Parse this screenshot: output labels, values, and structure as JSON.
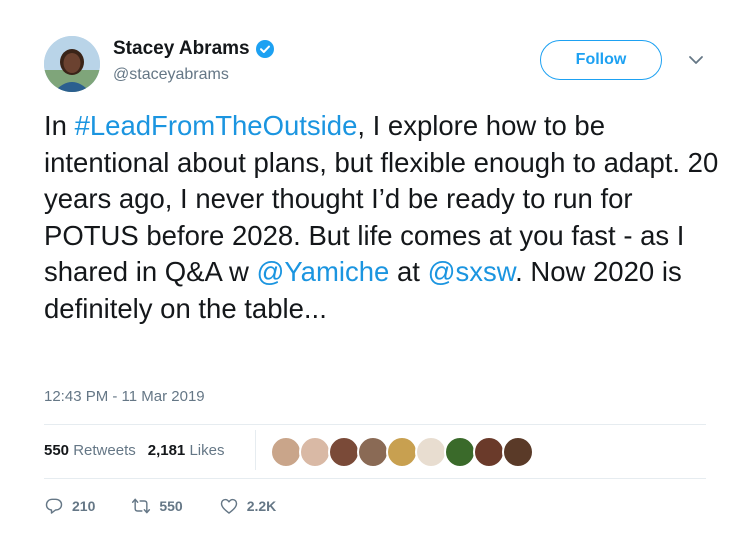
{
  "author": {
    "display_name": "Stacey Abrams",
    "handle": "@staceyabrams",
    "verified": true
  },
  "follow_button": {
    "label": "Follow"
  },
  "tweet": {
    "segments": [
      {
        "text": "In ",
        "link": false
      },
      {
        "text": "#LeadFromTheOutside",
        "link": true
      },
      {
        "text": ", I explore how to be intentional about plans, but flexible enough to adapt. 20 years ago, I never thought I’d be ready to run for POTUS before 2028. But life comes at you fast - as I shared in Q&A w ",
        "link": false
      },
      {
        "text": "@Yamiche",
        "link": true
      },
      {
        "text": " at ",
        "link": false
      },
      {
        "text": "@sxsw",
        "link": true
      },
      {
        "text": ". Now 2020 is definitely on the table...",
        "link": false
      }
    ],
    "timestamp": "12:43 PM - 11 Mar 2019"
  },
  "stats": {
    "retweets_count": "550",
    "retweets_label": "Retweets",
    "likes_count": "2,181",
    "likes_label": "Likes"
  },
  "likers": [
    "#c9a58a",
    "#d9b9a5",
    "#7a4a38",
    "#8a6a55",
    "#c8a050",
    "#e8ddd0",
    "#3a6a2a",
    "#6a3a2a",
    "#5a3a28"
  ],
  "actions": {
    "replies": "210",
    "retweets": "550",
    "likes": "2.2K"
  },
  "colors": {
    "accent": "#1da1f2",
    "link": "#1b95e0",
    "muted": "#657786"
  }
}
